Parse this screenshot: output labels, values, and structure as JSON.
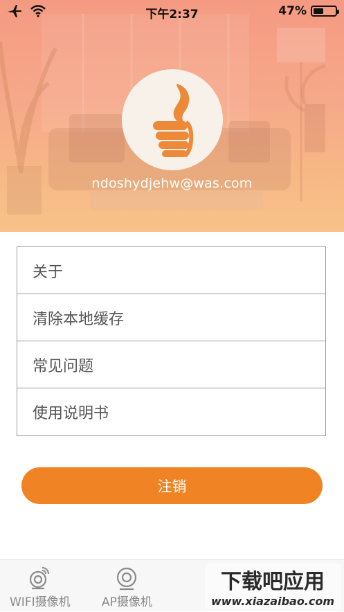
{
  "status_bar": {
    "time": "下午2:37",
    "battery_percent": "47%",
    "battery_level": 0.47,
    "icons": [
      "airplane-icon",
      "wifi-icon",
      "battery-icon"
    ]
  },
  "profile": {
    "email": "ndoshydjehw@was.com",
    "avatar_icon": "thumbs-up-logo-icon"
  },
  "menu": {
    "items": [
      {
        "label": "关于"
      },
      {
        "label": "清除本地缓存"
      },
      {
        "label": "常见问题"
      },
      {
        "label": "使用说明书"
      }
    ]
  },
  "logout": {
    "label": "注销"
  },
  "tabbar": {
    "tabs": [
      {
        "label": "WIFI摄像机",
        "icon": "camera-wifi-icon"
      },
      {
        "label": "AP摄像机",
        "icon": "camera-icon"
      }
    ]
  },
  "watermark": {
    "title": "下载吧应用",
    "url": "www.xiazaibao.com"
  },
  "colors": {
    "accent": "#f08424",
    "header_top": "#f59a82",
    "header_bottom": "#f8c28a"
  }
}
